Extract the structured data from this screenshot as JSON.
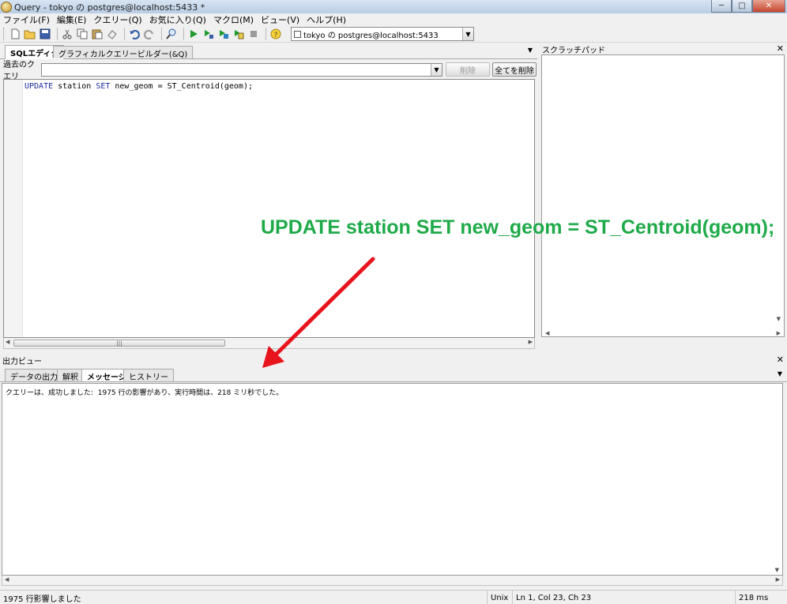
{
  "window": {
    "title": "Query - tokyo の postgres@localhost:5433 *",
    "min_glyph": "─",
    "max_glyph": "□",
    "close_glyph": "✕"
  },
  "menu": [
    "ファイル(F)",
    "編集(E)",
    "クエリー(Q)",
    "お気に入り(Q)",
    "マクロ(M)",
    "ビュー(V)",
    "ヘルプ(H)"
  ],
  "toolbar": {
    "connection": "tokyo の postgres@localhost:5433",
    "icons": [
      "new-file-icon",
      "open-icon",
      "save-icon",
      "cut-icon",
      "copy-icon",
      "paste-icon",
      "clear-icon",
      "undo-icon",
      "redo-icon",
      "find-icon",
      "execute-icon",
      "explain-icon",
      "explain-analyze-icon",
      "execute-to-file-icon",
      "stop-icon",
      "help-icon"
    ]
  },
  "editor": {
    "tabs": [
      "SQLエディタ",
      "グラフィカルクエリービルダー(&Q)"
    ],
    "active_tab": "SQLエディタ",
    "past_query_label": "過去のクエリ",
    "delete_label": "削除",
    "delete_all_label": "全てを削除",
    "code": {
      "kw1": "UPDATE",
      "t1": " station ",
      "kw2": "SET",
      "t2": " new_geom = ST_Centroid(geom);"
    }
  },
  "scratch": {
    "title": "スクラッチパッド"
  },
  "output": {
    "title": "出力ビュー",
    "tabs": [
      "データの出力",
      "解釈",
      "メッセージ",
      "ヒストリー"
    ],
    "active_tab": "メッセージ",
    "message": "クエリーは、成功しました:  1975 行の影響があり、実行時間は、218 ミリ秒でした。"
  },
  "status": {
    "message": "1975 行影響しました",
    "line_ending": "Unix",
    "position": "Ln 1, Col 23, Ch 23",
    "time": "218 ms"
  },
  "annotation": {
    "text": "UPDATE station SET new_geom = ST_Centroid(geom);",
    "color": "#1faa49",
    "arrow_color": "#e8141c"
  }
}
